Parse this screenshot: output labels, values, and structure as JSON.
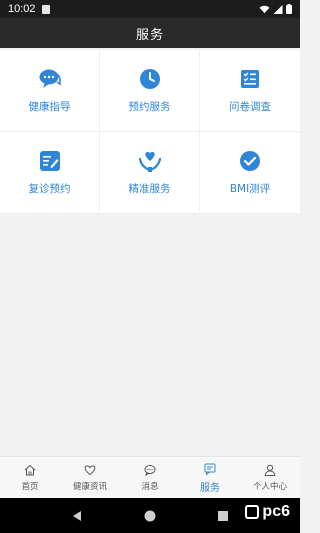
{
  "status_bar": {
    "time": "10:02"
  },
  "header": {
    "title": "服务"
  },
  "services": [
    {
      "label": "健康指导",
      "icon": "chat-bubbles-icon"
    },
    {
      "label": "预约服务",
      "icon": "clock-icon"
    },
    {
      "label": "问卷调查",
      "icon": "checklist-icon"
    },
    {
      "label": "复诊预约",
      "icon": "edit-note-icon"
    },
    {
      "label": "精准服务",
      "icon": "heart-hands-icon"
    },
    {
      "label": "BMI测评",
      "icon": "check-circle-icon"
    }
  ],
  "tabs": [
    {
      "label": "首页",
      "icon": "home-icon"
    },
    {
      "label": "健康资讯",
      "icon": "heart-outline-icon"
    },
    {
      "label": "消息",
      "icon": "message-icon"
    },
    {
      "label": "服务",
      "icon": "service-icon",
      "active": true
    },
    {
      "label": "个人中心",
      "icon": "person-icon"
    }
  ],
  "colors": {
    "accent": "#2f86d8",
    "header_bg": "#2a2a2a",
    "status_bg": "#1c1c1c"
  },
  "watermark": {
    "text": "pc6"
  }
}
